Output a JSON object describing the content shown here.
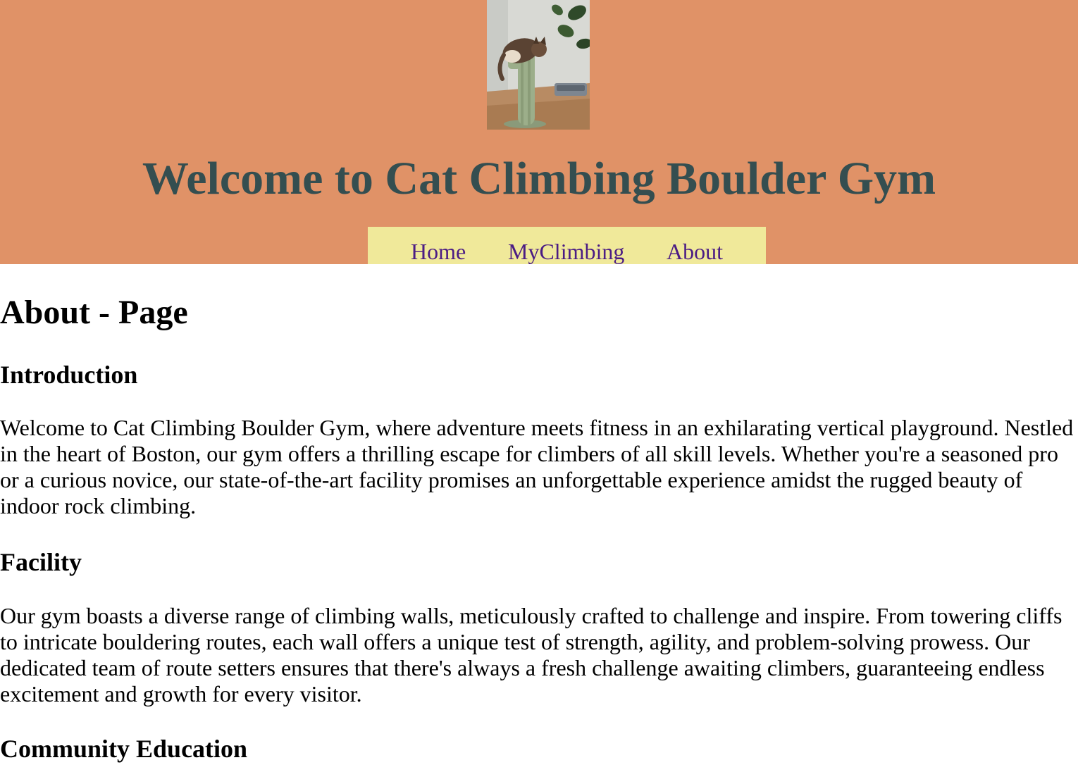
{
  "header": {
    "title": "Welcome to Cat Climbing Boulder Gym",
    "logo_alt": "Cat climbing a cactus scratching post"
  },
  "nav": {
    "items": [
      {
        "label": "Home"
      },
      {
        "label": "MyClimbing"
      },
      {
        "label": "About"
      }
    ]
  },
  "main": {
    "page_title": "About - Page",
    "sections": [
      {
        "heading": "Introduction",
        "text": "Welcome to Cat Climbing Boulder Gym, where adventure meets fitness in an exhilarating vertical playground. Nestled in the heart of Boston, our gym offers a thrilling escape for climbers of all skill levels. Whether you're a seasoned pro or a curious novice, our state-of-the-art facility promises an unforgettable experience amidst the rugged beauty of indoor rock climbing."
      },
      {
        "heading": "Facility",
        "text": "Our gym boasts a diverse range of climbing walls, meticulously crafted to challenge and inspire. From towering cliffs to intricate bouldering routes, each wall offers a unique test of strength, agility, and problem-solving prowess. Our dedicated team of route setters ensures that there's always a fresh challenge awaiting climbers, guaranteeing endless excitement and growth for every visitor."
      },
      {
        "heading": "Community Education"
      }
    ]
  },
  "colors": {
    "header_bg": "#e09267",
    "title": "#344e50",
    "nav_bg": "#f0e99a",
    "nav_link": "#4b1c84"
  }
}
